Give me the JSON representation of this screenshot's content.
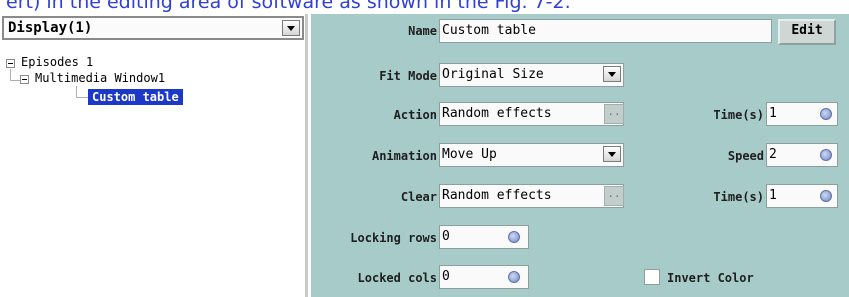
{
  "caption": "ert) in the editing area of software as shown in the Fig. 7-2.",
  "left_panel": {
    "display_value": "Display(1)",
    "tree": {
      "root": "Episodes 1",
      "child": "Multimedia Window1",
      "leaf": "Custom table"
    }
  },
  "form": {
    "name_label": "Name",
    "name_value": "Custom table",
    "edit_label": "Edit",
    "fit_mode_label": "Fit Mode",
    "fit_mode_value": "Original Size",
    "action_label": "Action",
    "action_value": "Random effects",
    "time_label_1": "Time(s)",
    "time_value_1": "1",
    "animation_label": "Animation",
    "animation_value": "Move Up",
    "speed_label": "Speed",
    "speed_value": "2",
    "clear_label": "Clear",
    "clear_value": "Random effects",
    "time_label_2": "Time(s)",
    "time_value_2": "1",
    "locking_rows_label": "Locking rows",
    "locking_rows_value": "0",
    "locked_cols_label": "Locked cols",
    "locked_cols_value": "0",
    "invert_color_label": "Invert Color",
    "invert_color_checked": false,
    "ellipsis_label": ".."
  },
  "colors": {
    "panel_bg": "#a6cbc8",
    "selection": "#1b38c8",
    "caption": "#2f3fd9"
  }
}
